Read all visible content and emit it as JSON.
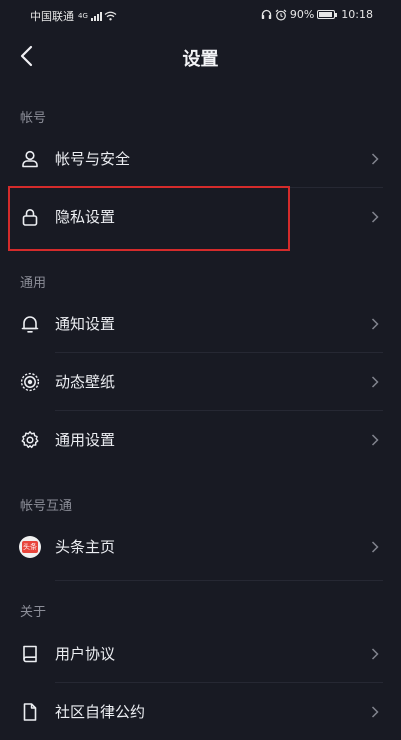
{
  "statusbar": {
    "carrier": "中国联通",
    "network": "4G",
    "battery": "90%",
    "time": "10:18",
    "battery_level": 0.9
  },
  "header": {
    "title": "设置"
  },
  "sections": [
    {
      "label": "帐号",
      "items": [
        {
          "label": "帐号与安全",
          "icon": "user-icon"
        },
        {
          "label": "隐私设置",
          "icon": "lock-icon"
        }
      ]
    },
    {
      "label": "通用",
      "items": [
        {
          "label": "通知设置",
          "icon": "bell-icon"
        },
        {
          "label": "动态壁纸",
          "icon": "wallpaper-icon"
        },
        {
          "label": "通用设置",
          "icon": "gear-icon"
        }
      ]
    },
    {
      "label": "帐号互通",
      "items": [
        {
          "label": "头条主页",
          "icon": "toutiao-icon",
          "icon_text": "头条"
        }
      ]
    },
    {
      "label": "关于",
      "items": [
        {
          "label": "用户协议",
          "icon": "book-icon"
        },
        {
          "label": "社区自律公约",
          "icon": "document-icon"
        }
      ]
    }
  ],
  "colors": {
    "background": "#181a23",
    "highlight_box": "#d42b2b",
    "section_label": "#8c8e98"
  }
}
